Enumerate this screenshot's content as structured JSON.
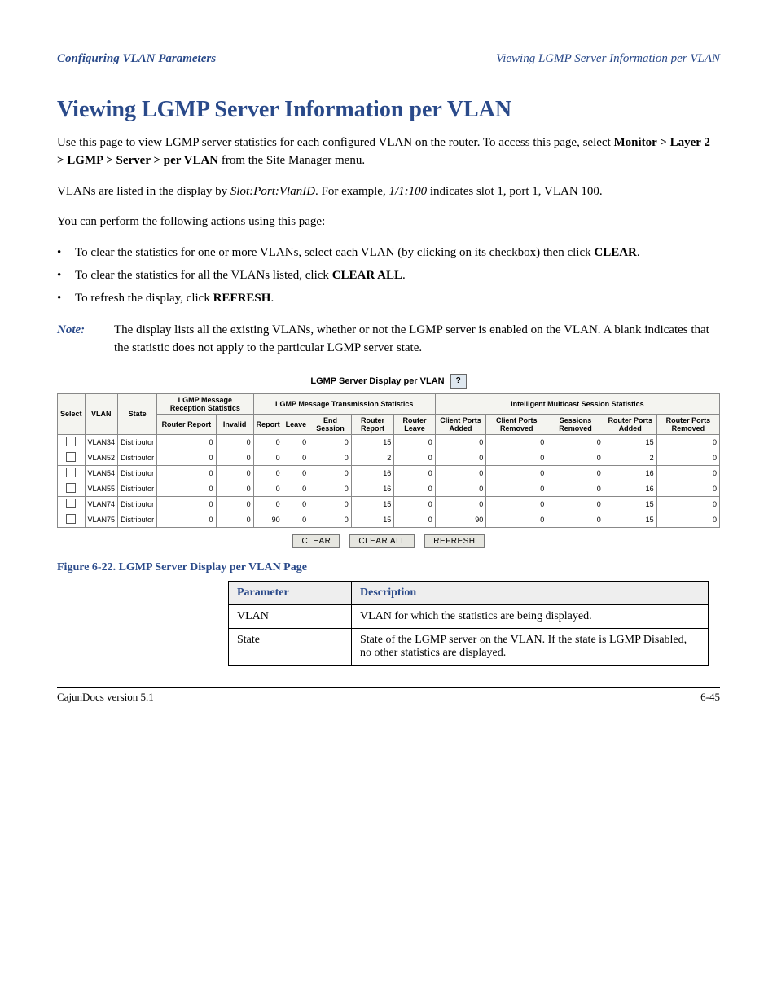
{
  "header": {
    "left": "Configuring VLAN Parameters",
    "right": "Viewing LGMP Server Information per VLAN"
  },
  "section_title": "Viewing LGMP Server Information per VLAN",
  "intro_1_pre": "Use this page to view LGMP server statistics for each configured VLAN on the router. To access this page, select ",
  "intro_1_bold": "Monitor > Layer 2 > LGMP > Server > per VLAN",
  "intro_1_post": " from the Site Manager menu.",
  "intro_2_pre": "VLANs are listed in the display by ",
  "intro_2_ital": "Slot:Port:VlanID",
  "intro_2_mid": ". For example, ",
  "intro_2_ital2": "1/1:100",
  "intro_2_post": " indicates slot 1, port 1, VLAN 100.",
  "intro_3": "You can perform the following actions using this page:",
  "bullets": [
    {
      "pre": "To clear the statistics for one or more VLANs, select each VLAN (by clicking on its checkbox) then click ",
      "btn": "CLEAR",
      "post": "."
    },
    {
      "pre": "To clear the statistics for all the VLANs listed, click ",
      "btn": "CLEAR ALL",
      "post": "."
    },
    {
      "pre": "To refresh the display, click ",
      "btn": "REFRESH",
      "post": "."
    }
  ],
  "note": {
    "head": "Note:",
    "body": "The display lists all the existing VLANs, whether or not the LGMP server is enabled on the VLAN. A blank indicates that the statistic does not apply to the particular LGMP server state."
  },
  "figure": {
    "title": "LGMP Server Display per VLAN",
    "help_glyph": "?",
    "header_group1": "LGMP Message Reception Statistics",
    "header_group2": "LGMP Message Transmission Statistics",
    "header_group3": "Intelligent Multicast Session Statistics",
    "cols": [
      "Select",
      "VLAN",
      "State",
      "Router Report",
      "Invalid",
      "Report",
      "Leave",
      "End Session",
      "Router Report",
      "Router Leave",
      "Client Ports Added",
      "Client Ports Removed",
      "Sessions Removed",
      "Router Ports Added",
      "Router Ports Removed"
    ],
    "rows": [
      {
        "vlan": "VLAN34",
        "state": "Distributor",
        "rr": 0,
        "inv": 0,
        "rep": 0,
        "lv": 0,
        "es": 0,
        "trr": 15,
        "trl": 0,
        "cpa": 0,
        "cpr": 0,
        "sr": 0,
        "rpa": 15,
        "rprm": 0
      },
      {
        "vlan": "VLAN52",
        "state": "Distributor",
        "rr": 0,
        "inv": 0,
        "rep": 0,
        "lv": 0,
        "es": 0,
        "trr": 2,
        "trl": 0,
        "cpa": 0,
        "cpr": 0,
        "sr": 0,
        "rpa": 2,
        "rprm": 0
      },
      {
        "vlan": "VLAN54",
        "state": "Distributor",
        "rr": 0,
        "inv": 0,
        "rep": 0,
        "lv": 0,
        "es": 0,
        "trr": 16,
        "trl": 0,
        "cpa": 0,
        "cpr": 0,
        "sr": 0,
        "rpa": 16,
        "rprm": 0
      },
      {
        "vlan": "VLAN55",
        "state": "Distributor",
        "rr": 0,
        "inv": 0,
        "rep": 0,
        "lv": 0,
        "es": 0,
        "trr": 16,
        "trl": 0,
        "cpa": 0,
        "cpr": 0,
        "sr": 0,
        "rpa": 16,
        "rprm": 0
      },
      {
        "vlan": "VLAN74",
        "state": "Distributor",
        "rr": 0,
        "inv": 0,
        "rep": 0,
        "lv": 0,
        "es": 0,
        "trr": 15,
        "trl": 0,
        "cpa": 0,
        "cpr": 0,
        "sr": 0,
        "rpa": 15,
        "rprm": 0
      },
      {
        "vlan": "VLAN75",
        "state": "Distributor",
        "rr": 0,
        "inv": 0,
        "rep": 90,
        "lv": 0,
        "es": 0,
        "trr": 15,
        "trl": 0,
        "cpa": 90,
        "cpr": 0,
        "sr": 0,
        "rpa": 15,
        "rprm": 0
      }
    ],
    "buttons": {
      "clear": "CLEAR",
      "clear_all": "CLEAR ALL",
      "refresh": "REFRESH"
    }
  },
  "figure_caption": "Figure 6-22.  LGMP Server Display per VLAN Page",
  "param_table": {
    "headers": [
      "Parameter",
      "Description"
    ],
    "rows": [
      {
        "p": "VLAN",
        "d": "VLAN for which the statistics are being displayed."
      },
      {
        "p": "State",
        "d": "State of the LGMP server on the VLAN. If the state is LGMP Disabled, no other statistics are displayed."
      }
    ]
  },
  "footer": {
    "left": "CajunDocs version 5.1",
    "right": "6-45"
  }
}
